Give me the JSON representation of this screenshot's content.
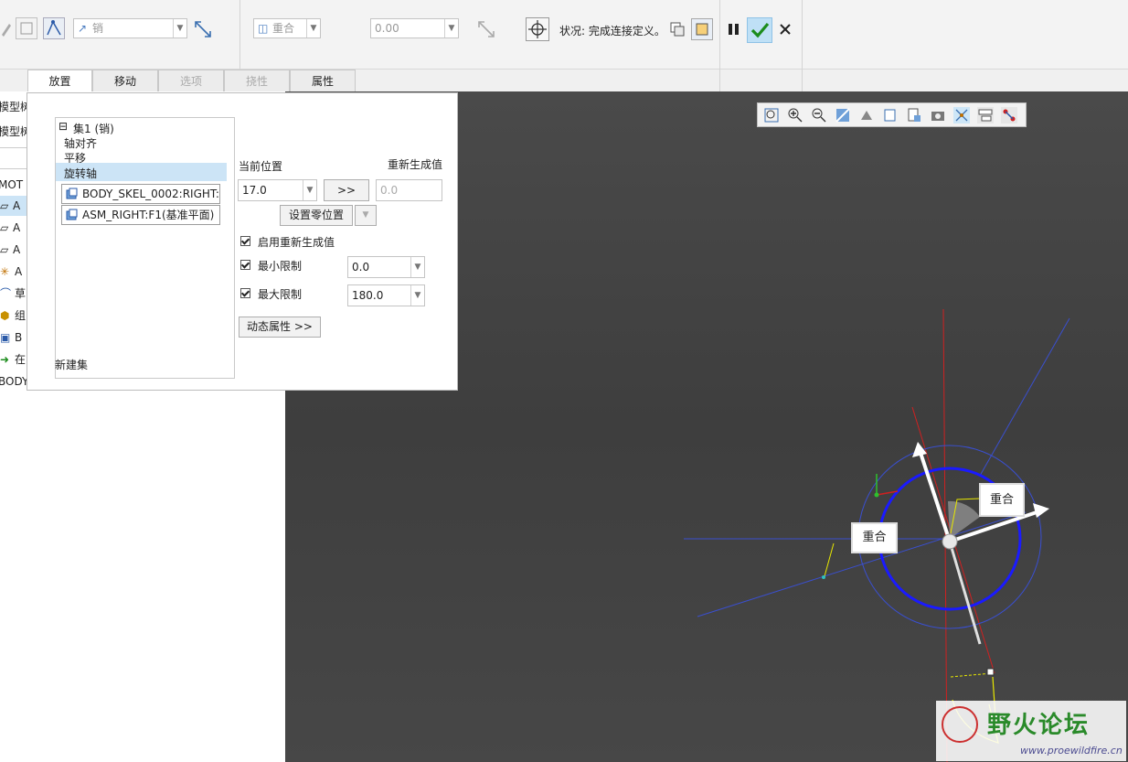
{
  "ribbon": {
    "constraint_type": "销",
    "constraint_type_icon": "pin-constraint-icon",
    "offset_type": "重合",
    "offset_value": "0.00",
    "status_label": "状况:",
    "status_value": "完成连接定义。"
  },
  "tabs": [
    {
      "label": "放置",
      "state": "active"
    },
    {
      "label": "移动",
      "state": "normal"
    },
    {
      "label": "选项",
      "state": "disabled"
    },
    {
      "label": "挠性",
      "state": "disabled"
    },
    {
      "label": "属性",
      "state": "normal"
    }
  ],
  "tree": {
    "header1": "模型树",
    "header2": "模型树",
    "rows": [
      "MOT",
      "A",
      "A",
      "A",
      "A",
      "草",
      "组",
      "B",
      "在",
      "BODY"
    ]
  },
  "placement": {
    "set_title": "集1 (销)",
    "constraints": [
      "轴对齐",
      "平移",
      "旋转轴"
    ],
    "references": [
      "BODY_SKEL_0002:RIGHT:",
      "ASM_RIGHT:F1(基准平面)"
    ],
    "new_set": "新建集",
    "current_position_label": "当前位置",
    "current_position_value": "17.0",
    "arrow_button": ">>",
    "regen_label": "重新生成值",
    "regen_value": "0.0",
    "set_zero_button": "设置零位置",
    "enable_regen_label": "启用重新生成值",
    "min_limit_label": "最小限制",
    "min_limit_value": "0.0",
    "max_limit_label": "最大限制",
    "max_limit_value": "180.0",
    "dynamic_props_button": "动态属性 >>"
  },
  "viewport": {
    "label1": "重合",
    "label2": "重合",
    "watermark_title": "野火论坛",
    "watermark_url": "www.proewildfire.cn"
  },
  "colors": {
    "accent": "#cde6f7",
    "selected_row": "#cce4f6",
    "confirm_green": "#1c8c1c",
    "circle_blue": "#1a1aff",
    "axis_red": "#d02020"
  }
}
